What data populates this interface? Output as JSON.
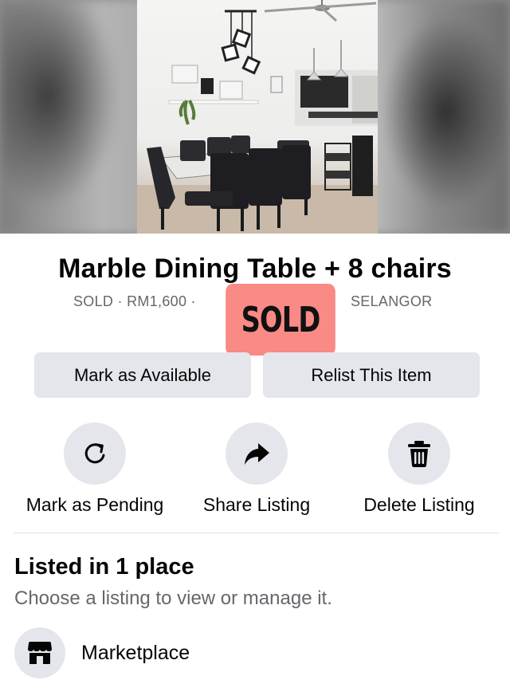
{
  "listing": {
    "title": "Marble Dining Table + 8 chairs",
    "meta_left": "SOLD · RM1,600 ·",
    "meta_right": "SELANGOR",
    "status_badge": "SOLD"
  },
  "primary_actions": {
    "mark_available": "Mark as Available",
    "relist": "Relist This Item"
  },
  "secondary_actions": [
    {
      "label": "Mark as Pending",
      "icon": "refresh-icon"
    },
    {
      "label": "Share Listing",
      "icon": "share-arrow-icon"
    },
    {
      "label": "Delete Listing",
      "icon": "trash-icon"
    }
  ],
  "listed_in": {
    "title": "Listed in 1 place",
    "subtitle": "Choose a listing to view or manage it.",
    "places": [
      {
        "label": "Marketplace",
        "icon": "storefront-icon"
      }
    ]
  },
  "colors": {
    "button_bg": "#e4e6eb",
    "secondary_text": "#65676b",
    "sold_badge": "#f98a86"
  }
}
